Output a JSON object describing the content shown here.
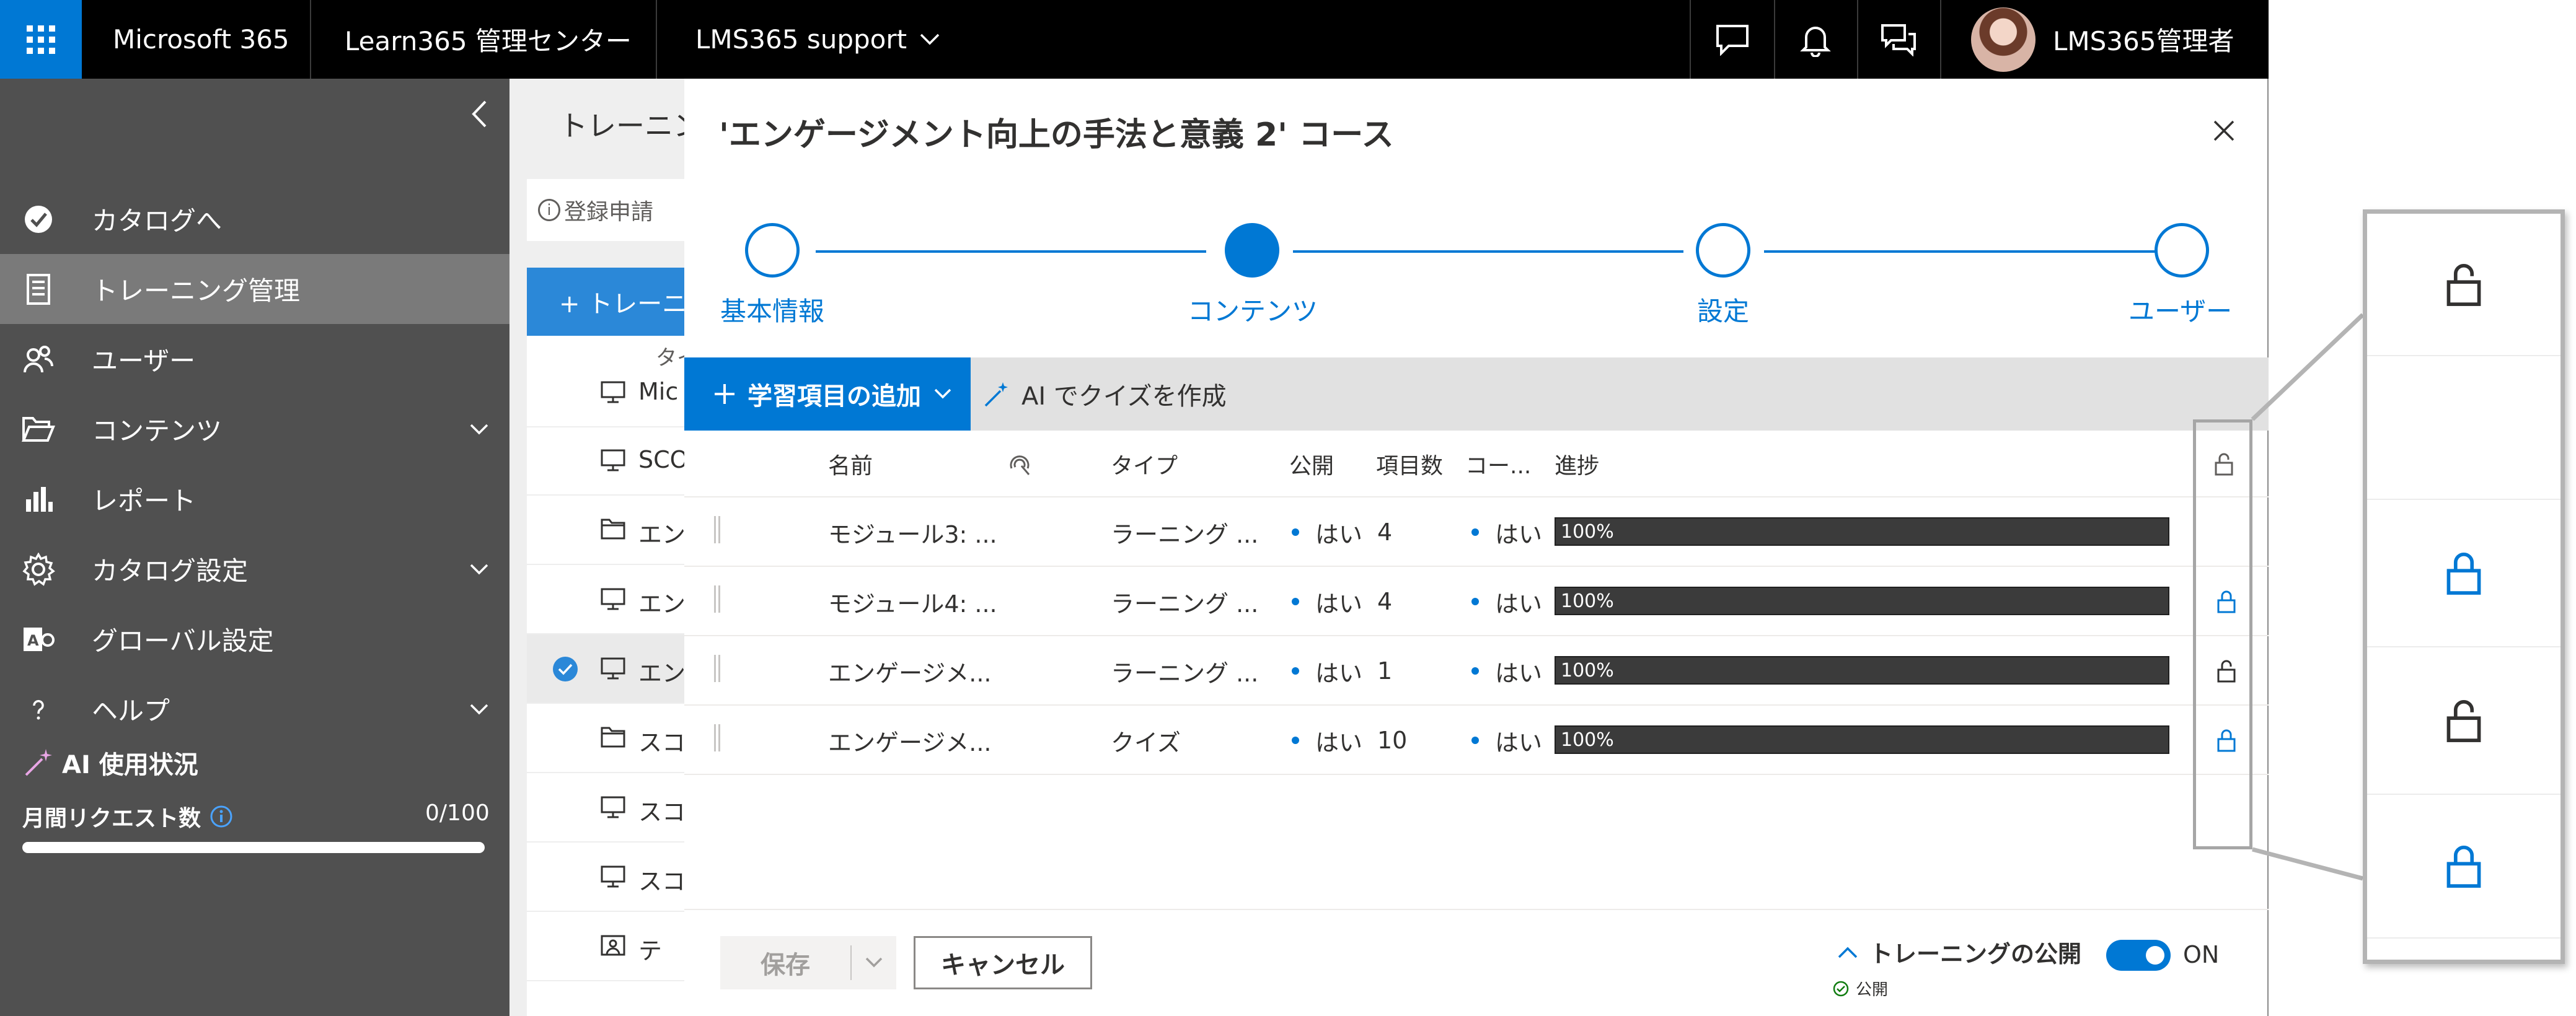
{
  "topbar": {
    "app_name": "Microsoft 365",
    "admin_center": "Learn365 管理センター",
    "tenant": "LMS365 support",
    "user_name": "LMS365管理者",
    "icons": [
      "waffle-icon",
      "chat-icon",
      "bell-icon",
      "feedback-icon"
    ]
  },
  "sidebar": {
    "items": [
      {
        "label": "カタログへ",
        "icon": "catalog-icon",
        "expandable": false,
        "active": false
      },
      {
        "label": "トレーニング管理",
        "icon": "training-icon",
        "expandable": false,
        "active": true
      },
      {
        "label": "ユーザー",
        "icon": "users-icon",
        "expandable": false,
        "active": false
      },
      {
        "label": "コンテンツ",
        "icon": "folder-icon",
        "expandable": true,
        "active": false
      },
      {
        "label": "レポート",
        "icon": "chart-icon",
        "expandable": false,
        "active": false
      },
      {
        "label": "カタログ設定",
        "icon": "gear-icon",
        "expandable": true,
        "active": false
      },
      {
        "label": "グローバル設定",
        "icon": "global-settings-icon",
        "expandable": false,
        "active": false
      },
      {
        "label": "ヘルプ",
        "icon": "help-icon",
        "expandable": true,
        "active": false
      }
    ],
    "ai_usage_label": "AI 使用状況",
    "monthly_requests_label": "月間リクエスト数",
    "monthly_requests_value": "0/100",
    "monthly_requests_fraction": 0
  },
  "background_page": {
    "title": "トレーニン",
    "info_text": "登録申請",
    "add_button": "+ トレーニ",
    "list_header": "タイ",
    "rows": [
      {
        "text": "Mic",
        "icon": "monitor-icon"
      },
      {
        "text": "SCO",
        "icon": "monitor-icon"
      },
      {
        "text": "エン",
        "icon": "folder-icon"
      },
      {
        "text": "エン",
        "icon": "monitor-icon"
      },
      {
        "text": "エン",
        "icon": "monitor-icon",
        "selected": true
      },
      {
        "text": "スコ",
        "icon": "folder-icon"
      },
      {
        "text": "スコ",
        "icon": "monitor-icon"
      },
      {
        "text": "スコ",
        "icon": "monitor-icon"
      },
      {
        "text": "テ",
        "icon": "classroom-icon"
      }
    ]
  },
  "panel": {
    "title": "'エンゲージメント向上の手法と意義 2' コース",
    "steps": [
      {
        "label": "基本情報",
        "state": "done"
      },
      {
        "label": "コンテンツ",
        "state": "current"
      },
      {
        "label": "設定",
        "state": "todo"
      },
      {
        "label": "ユーザー",
        "state": "todo"
      }
    ],
    "toolbar": {
      "add_label": "学習項目の追加",
      "quiz_label": "AI でクイズを作成"
    },
    "table": {
      "headers": [
        "名前",
        "タイプ",
        "公開",
        "項目数",
        "コー...",
        "進捗"
      ],
      "rows": [
        {
          "name": "モジュール3: ...",
          "type": "ラーニング ...",
          "published": "はい",
          "count": "4",
          "course": "はい",
          "progress": "100%",
          "progress_value": 1.0,
          "lock": "none"
        },
        {
          "name": "モジュール4: ...",
          "type": "ラーニング ...",
          "published": "はい",
          "count": "4",
          "course": "はい",
          "progress": "100%",
          "progress_value": 1.0,
          "lock": "locked-blue"
        },
        {
          "name": "エンゲージメ...",
          "type": "ラーニング ...",
          "published": "はい",
          "count": "1",
          "course": "はい",
          "progress": "100%",
          "progress_value": 1.0,
          "lock": "unlocked"
        },
        {
          "name": "エンゲージメ...",
          "type": "クイズ",
          "published": "はい",
          "count": "10",
          "course": "はい",
          "progress": "100%",
          "progress_value": 1.0,
          "lock": "locked-blue"
        }
      ]
    },
    "footer": {
      "save_label": "保存",
      "cancel_label": "キャンセル",
      "publish_title": "トレーニングの公開",
      "publish_status": "公開",
      "toggle_label": "ON",
      "toggle_on": true
    }
  },
  "zoom_callout": {
    "icons": [
      "unlocked",
      "blank",
      "locked-blue",
      "unlocked",
      "locked-blue"
    ]
  },
  "colors": {
    "accent": "#0078d4",
    "topbar": "#000000",
    "sidebar": "#505050",
    "sidebar_active": "#7a7a7a",
    "progress": "#3b3b3b"
  }
}
